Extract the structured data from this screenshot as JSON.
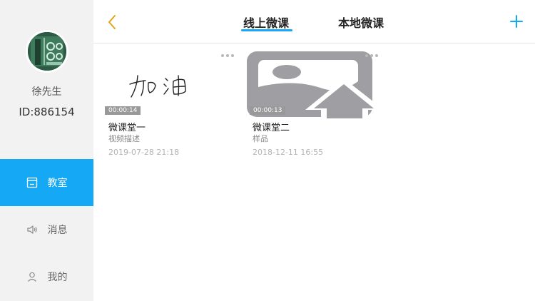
{
  "user": {
    "name": "徐先生",
    "id_text": "ID:886154"
  },
  "sidebar": {
    "items": [
      {
        "label": "教室",
        "icon": "classroom-icon",
        "active": true
      },
      {
        "label": "消息",
        "icon": "speaker-icon",
        "active": false
      },
      {
        "label": "我的",
        "icon": "person-icon",
        "active": false
      }
    ]
  },
  "header": {
    "tabs": [
      {
        "label": "线上微课",
        "active": true
      },
      {
        "label": "本地微课",
        "active": false
      }
    ],
    "back_icon": "chevron-left-icon",
    "add_icon": "plus-icon"
  },
  "lessons": [
    {
      "thumbnail_text": "加油",
      "duration": "00:00:14",
      "title": "微课堂一",
      "description": "视频描述",
      "date": "2019-07-28 21:18"
    },
    {
      "thumbnail_icon": "image-upload-icon",
      "duration": "00:00:13",
      "title": "微课堂二",
      "description": "样品",
      "date": "2018-12-11 16:55"
    }
  ],
  "colors": {
    "accent": "#14a8f5",
    "back_arrow": "#e6a31c",
    "sidebar_bg": "#f2f2f2"
  }
}
